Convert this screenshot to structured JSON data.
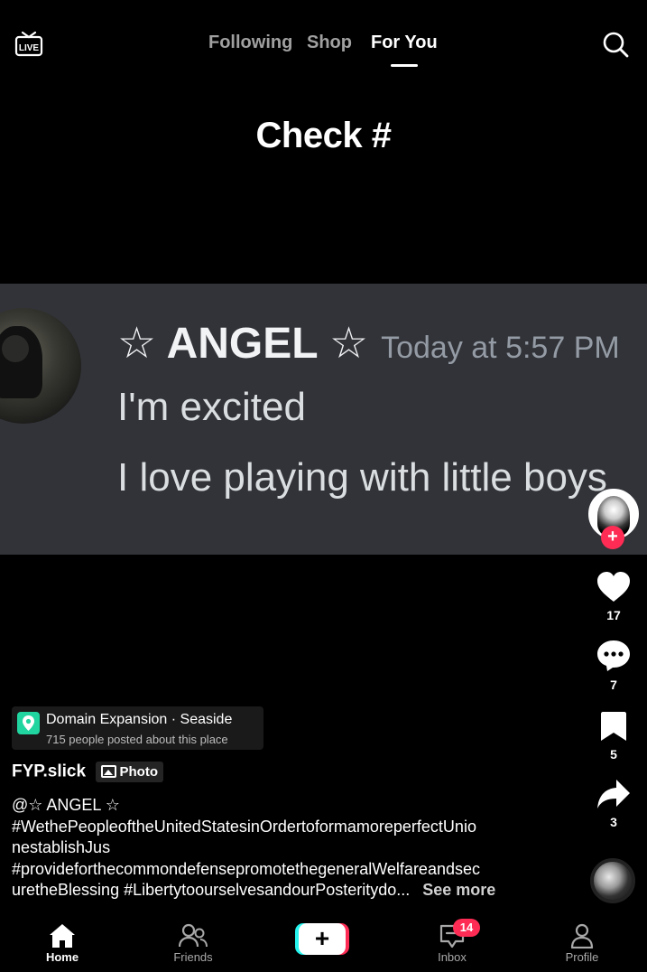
{
  "header": {
    "live_label": "LIVE",
    "tabs": [
      {
        "label": "Following",
        "active": false
      },
      {
        "label": "Shop",
        "active": false
      },
      {
        "label": "For You",
        "active": true
      }
    ],
    "search_icon": "search-icon"
  },
  "post": {
    "title": "Check #",
    "screenshot": {
      "username": "☆ ANGEL ☆",
      "timestamp": "Today at 5:57 PM",
      "lines": [
        "I'm excited",
        "I love playing with little boys"
      ]
    }
  },
  "actions": {
    "likes": "17",
    "comments": "7",
    "saves": "5",
    "shares": "3",
    "follow_icon": "plus-icon"
  },
  "location": {
    "name": "Domain Expansion · Seaside",
    "subtitle": "715 people posted about this place"
  },
  "author": {
    "name": "FYP.slick",
    "badge": "Photo"
  },
  "caption": {
    "lines": [
      "@☆ ANGEL ☆",
      "#WethePeopleoftheUnitedStatesinOrdertoformamoreperfectUnio",
      "nestablishJus",
      "#provideforthecommondefensepromotethegeneralWelfareandsec",
      "uretheBlessing #LibertytoourselvesandourPosteritydo..."
    ],
    "see_more": "See more"
  },
  "nav": {
    "home": "Home",
    "friends": "Friends",
    "create": "+",
    "inbox": "Inbox",
    "inbox_badge": "14",
    "profile": "Profile"
  },
  "colors": {
    "accent_red": "#fe2c55",
    "accent_cyan": "#25f4ee",
    "card_bg": "#313338",
    "location_pin": "#20d5a0"
  }
}
